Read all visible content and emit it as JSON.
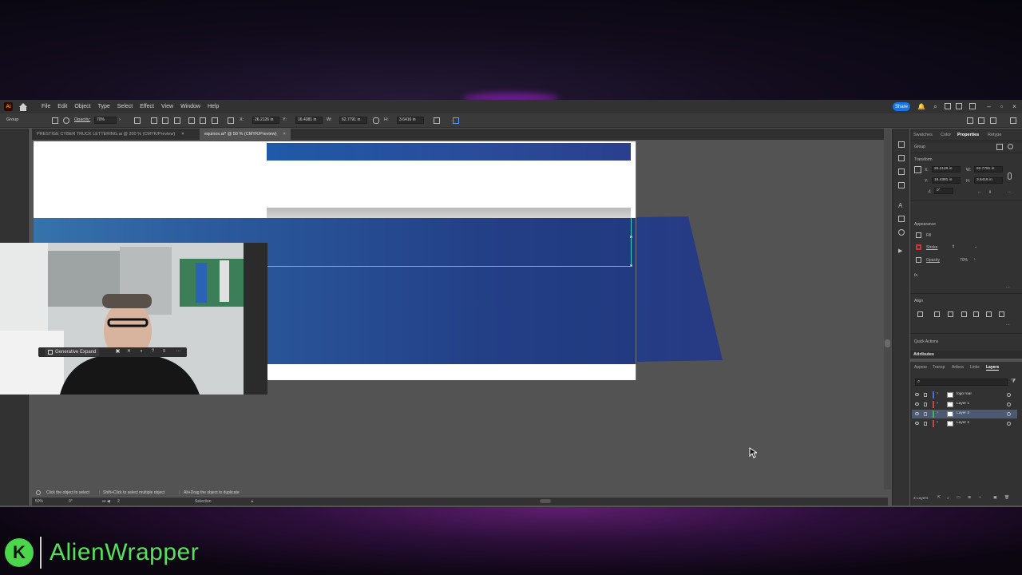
{
  "brand": {
    "logo_letter": "K",
    "name": "AlienWrapper",
    "color": "#59e05a"
  },
  "app": {
    "logo_text": "Ai",
    "menu": [
      "File",
      "Edit",
      "Object",
      "Type",
      "Select",
      "Effect",
      "View",
      "Window",
      "Help"
    ],
    "share_label": "Share"
  },
  "control_bar": {
    "selection_type": "Group",
    "opacity_label": "Opacity:",
    "opacity_value": "70%",
    "x_label": "X:",
    "x_value": "26.2126 in",
    "y_label": "Y:",
    "y_value": "16.4381 in",
    "w_label": "W:",
    "w_value": "62.7791 in",
    "h_label": "H:",
    "h_value": "3.6416 in"
  },
  "tabs": [
    {
      "label": "PRESTIGE CYBER TRUCK LETTERING.ai @ 200 % (CMYK/Preview)",
      "active": false
    },
    {
      "label": "equinox.ai* @ 50 % (CMYK/Preview)",
      "active": true
    }
  ],
  "generative_expand": {
    "label": "Generative Expand"
  },
  "status": {
    "hint_1": "Click the object to select",
    "hint_2": "Shift+Click to select multiple object",
    "hint_3": "Alt+Drag the object to duplicate",
    "zoom": "50%",
    "rotation": "0°",
    "artboard_num": "2",
    "tool": "Selection"
  },
  "properties_panel": {
    "tabs": [
      "Swatches",
      "Color",
      "Properties",
      "Retype"
    ],
    "active_tab": "Properties",
    "selection_label": "Group",
    "transform_title": "Transform",
    "x_label": "X:",
    "x_value": "26.2126 in",
    "y_label": "Y:",
    "y_value": "16.4381 in",
    "w_label": "W:",
    "w_value": "62.7791 in",
    "h_label": "H:",
    "h_value": "3.6416 in",
    "angle": "0°",
    "appearance_title": "Appearance",
    "fill_label": "Fill",
    "stroke_label": "Stroke",
    "opacity_label": "Opacity",
    "opacity_value": "70%",
    "fx_label": "fx.",
    "align_title": "Align",
    "quick_actions_title": "Quick Actions"
  },
  "attributes_panel": {
    "title": "Attributes"
  },
  "layers_panel": {
    "tabs": [
      "Appear",
      "Transp",
      "Artboa",
      "Links",
      "Layers"
    ],
    "active_tab": "Layers",
    "layers": [
      {
        "name": "logo roar",
        "color": "#4f6bd8",
        "selected": false
      },
      {
        "name": "Layer 1",
        "color": "#c04848",
        "selected": false
      },
      {
        "name": "Layer 3",
        "color": "#3fb650",
        "selected": true
      },
      {
        "name": "Layer 2",
        "color": "#c04848",
        "selected": false
      }
    ],
    "count_label": "4 Layers"
  },
  "colors": {
    "accent_blue": "#1473e6",
    "selection_cyan": "#3ad0c0",
    "banner_blue": "#233f86"
  }
}
